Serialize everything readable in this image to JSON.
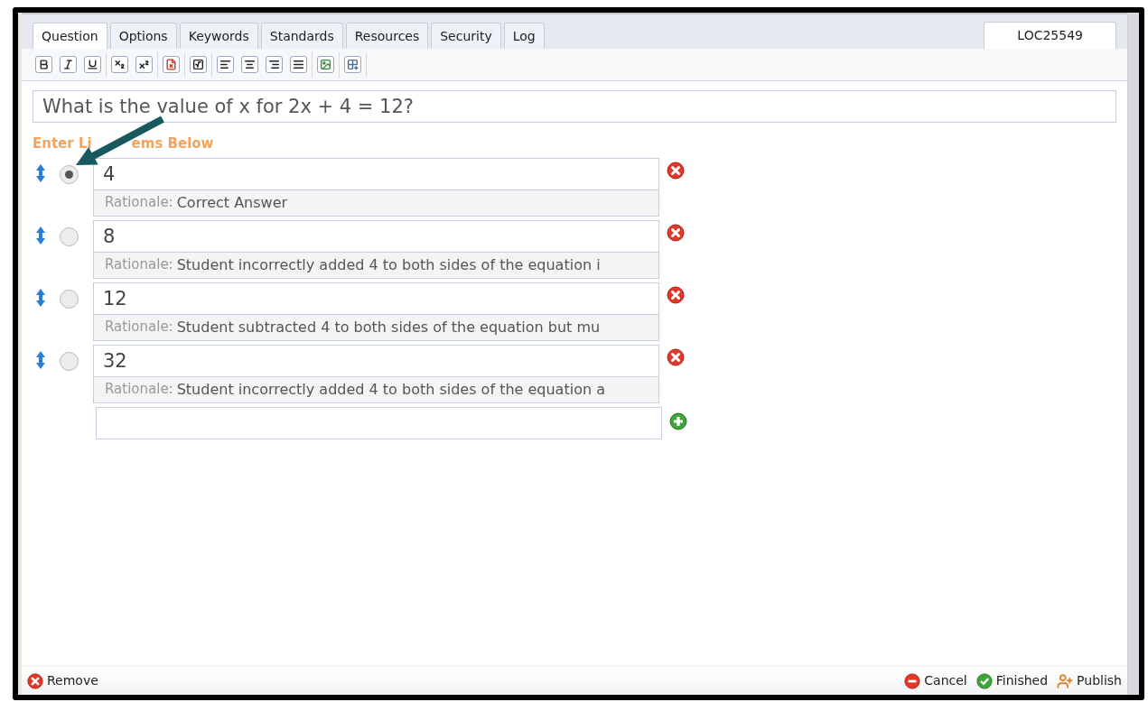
{
  "tabs": [
    {
      "label": "Question",
      "selected": true
    },
    {
      "label": "Options",
      "selected": false
    },
    {
      "label": "Keywords",
      "selected": false
    },
    {
      "label": "Standards",
      "selected": false
    },
    {
      "label": "Resources",
      "selected": false
    },
    {
      "label": "Security",
      "selected": false
    },
    {
      "label": "Log",
      "selected": false
    }
  ],
  "record_id": "LOC25549",
  "question": "What is the value of x for 2x + 4 = 12?",
  "list_label_parts": [
    "Enter Li",
    "ems Below"
  ],
  "options": [
    {
      "answer": "4",
      "selected": true,
      "rationale_label": "Rationale:",
      "rationale": "Correct Answer"
    },
    {
      "answer": "8",
      "selected": false,
      "rationale_label": "Rationale:",
      "rationale": "Student incorrectly added 4 to both sides of the equation i"
    },
    {
      "answer": "12",
      "selected": false,
      "rationale_label": "Rationale:",
      "rationale": "Student subtracted 4 to both sides of the equation but mu"
    },
    {
      "answer": "32",
      "selected": false,
      "rationale_label": "Rationale:",
      "rationale": "Student incorrectly added 4 to both sides of the equation a"
    }
  ],
  "remove": "Remove",
  "actions": [
    {
      "kind": "cancel",
      "label": "Cancel"
    },
    {
      "kind": "finished",
      "label": "Finished"
    },
    {
      "kind": "publish",
      "label": "Publish"
    }
  ]
}
